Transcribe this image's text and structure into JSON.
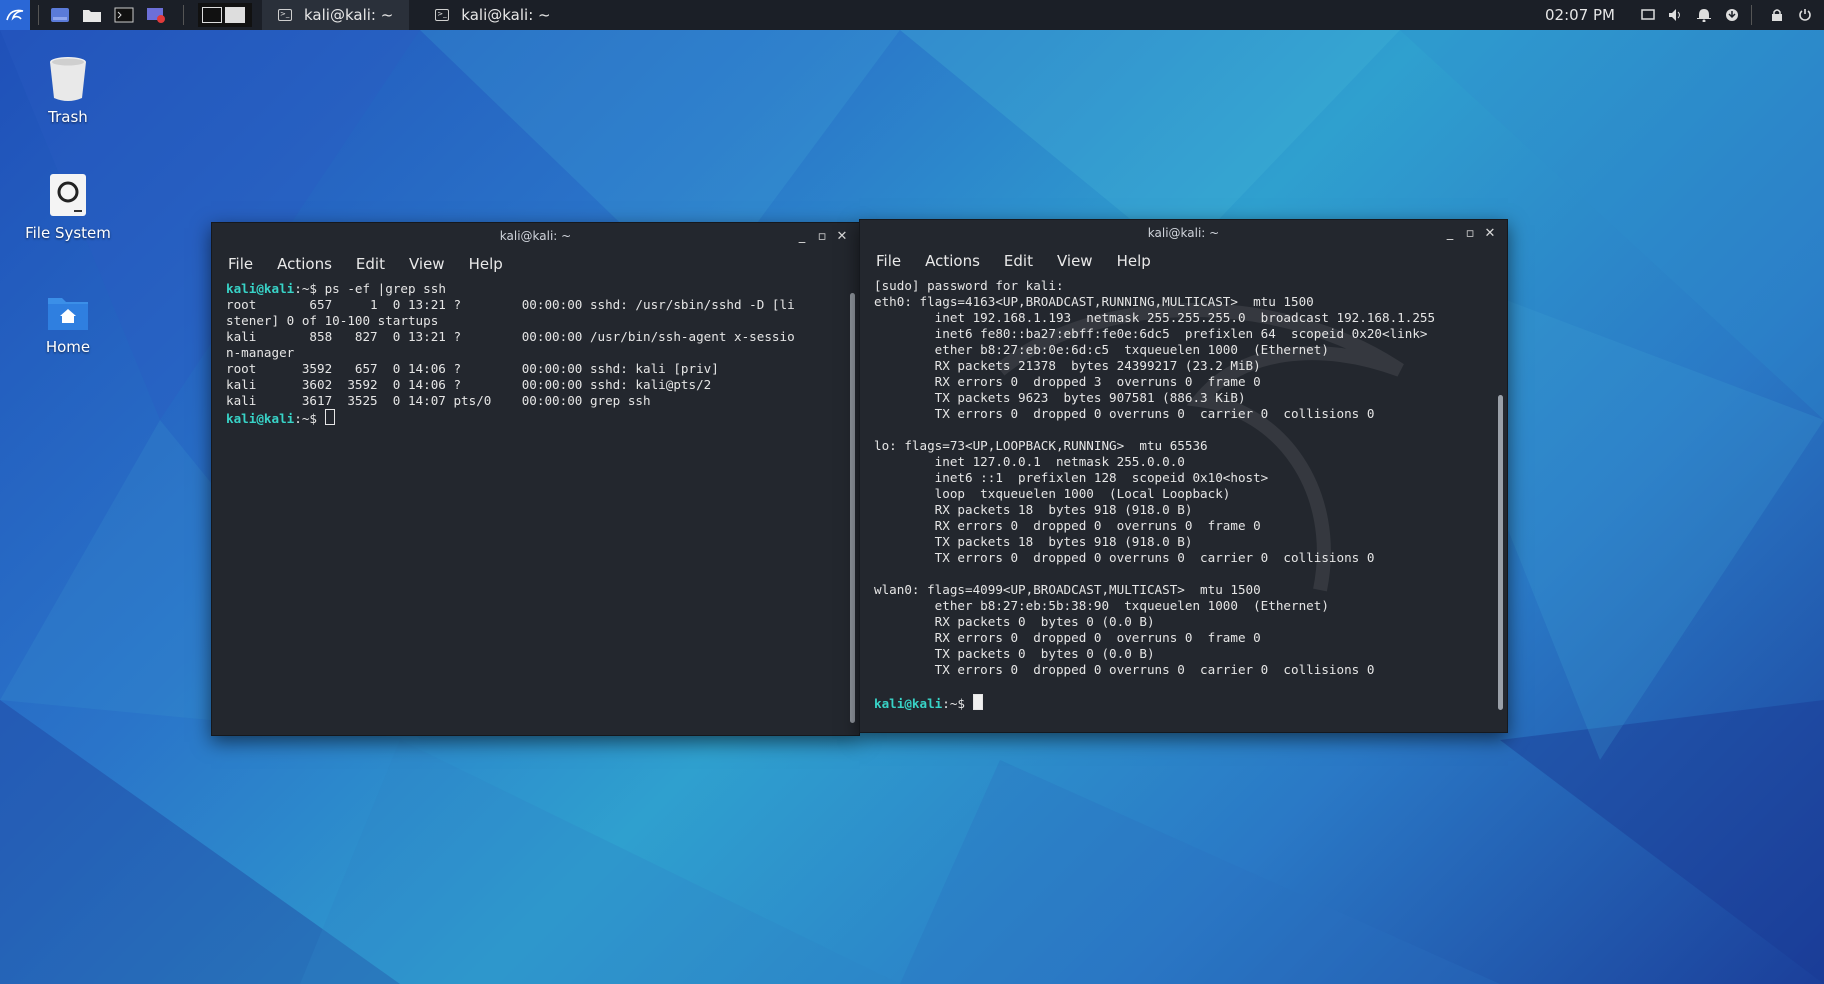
{
  "panel": {
    "clock": "02:07 PM",
    "tasks": [
      {
        "label": "kali@kali: ~",
        "active": true
      },
      {
        "label": "kali@kali: ~",
        "active": false
      }
    ]
  },
  "desktop": {
    "icons": [
      {
        "label": "Trash"
      },
      {
        "label": "File System"
      },
      {
        "label": "Home"
      }
    ]
  },
  "left_window": {
    "title": "kali@kali: ~",
    "menu": [
      "File",
      "Actions",
      "Edit",
      "View",
      "Help"
    ],
    "prompt": "kali@kali",
    "prompt_suffix": ":~$",
    "command": " ps -ef |grep ssh",
    "lines": [
      "root       657     1  0 13:21 ?        00:00:00 sshd: /usr/sbin/sshd -D [li",
      "stener] 0 of 10-100 startups",
      "kali       858   827  0 13:21 ?        00:00:00 /usr/bin/ssh-agent x-sessio",
      "n-manager",
      "root      3592   657  0 14:06 ?        00:00:00 sshd: kali [priv]",
      "kali      3602  3592  0 14:06 ?        00:00:00 sshd: kali@pts/2",
      "kali      3617  3525  0 14:07 pts/0    00:00:00 grep ssh"
    ]
  },
  "right_window": {
    "title": "kali@kali: ~",
    "menu": [
      "File",
      "Actions",
      "Edit",
      "View",
      "Help"
    ],
    "prompt": "kali@kali",
    "prompt_suffix": ":~$",
    "lines": [
      "[sudo] password for kali:",
      "eth0: flags=4163<UP,BROADCAST,RUNNING,MULTICAST>  mtu 1500",
      "        inet 192.168.1.193  netmask 255.255.255.0  broadcast 192.168.1.255",
      "        inet6 fe80::ba27:ebff:fe0e:6dc5  prefixlen 64  scopeid 0x20<link>",
      "        ether b8:27:eb:0e:6d:c5  txqueuelen 1000  (Ethernet)",
      "        RX packets 21378  bytes 24399217 (23.2 MiB)",
      "        RX errors 0  dropped 3  overruns 0  frame 0",
      "        TX packets 9623  bytes 907581 (886.3 KiB)",
      "        TX errors 0  dropped 0 overruns 0  carrier 0  collisions 0",
      "",
      "lo: flags=73<UP,LOOPBACK,RUNNING>  mtu 65536",
      "        inet 127.0.0.1  netmask 255.0.0.0",
      "        inet6 ::1  prefixlen 128  scopeid 0x10<host>",
      "        loop  txqueuelen 1000  (Local Loopback)",
      "        RX packets 18  bytes 918 (918.0 B)",
      "        RX errors 0  dropped 0  overruns 0  frame 0",
      "        TX packets 18  bytes 918 (918.0 B)",
      "        TX errors 0  dropped 0 overruns 0  carrier 0  collisions 0",
      "",
      "wlan0: flags=4099<UP,BROADCAST,MULTICAST>  mtu 1500",
      "        ether b8:27:eb:5b:38:90  txqueuelen 1000  (Ethernet)",
      "        RX packets 0  bytes 0 (0.0 B)",
      "        RX errors 0  dropped 0  overruns 0  frame 0",
      "        TX packets 0  bytes 0 (0.0 B)",
      "        TX errors 0  dropped 0 overruns 0  carrier 0  collisions 0",
      ""
    ]
  },
  "colors": {
    "prompt": "#38d3c7",
    "terminal_bg": "#23272e",
    "panel_bg": "#1b1f27"
  }
}
